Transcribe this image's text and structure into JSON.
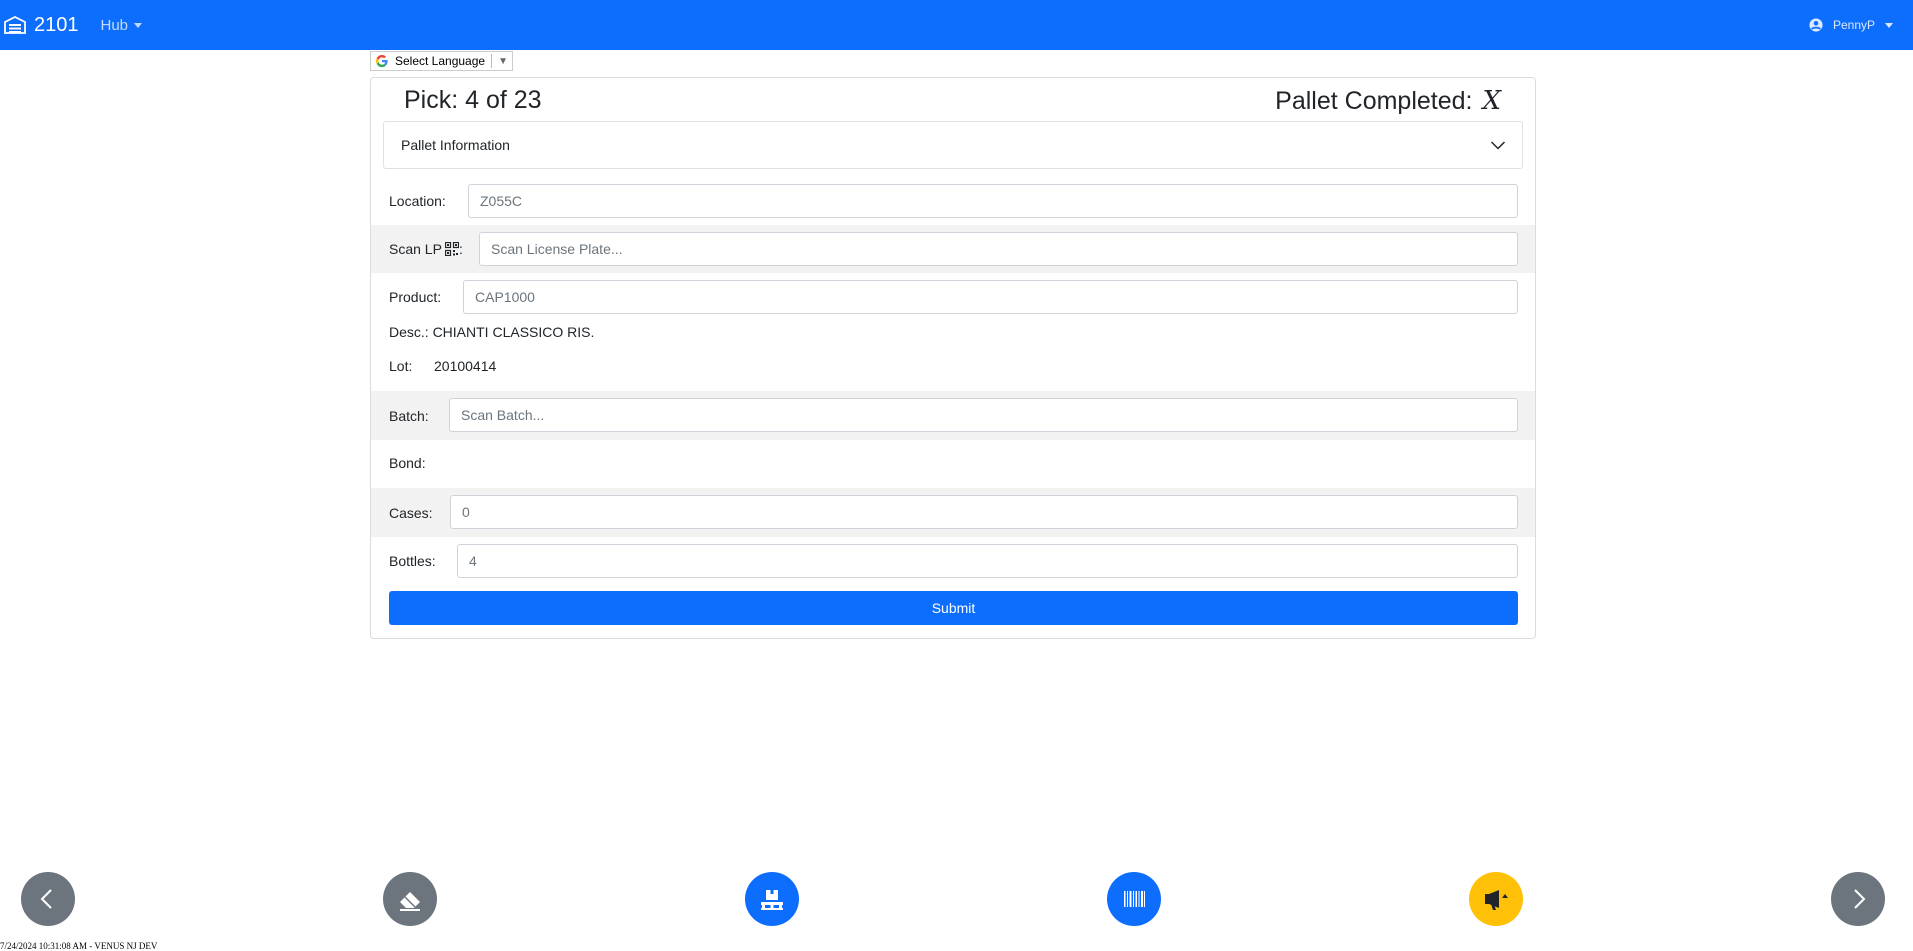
{
  "navbar": {
    "brand": "2101",
    "menu": "Hub",
    "user": "PennyP"
  },
  "translate": {
    "label": "Select Language",
    "arrow": "▼"
  },
  "pick": {
    "text": "Pick: 4 of 23",
    "pallet_completed_label": "Pallet Completed:",
    "pallet_completed_mark": "X"
  },
  "accordion": {
    "title": "Pallet Information"
  },
  "form": {
    "location": {
      "label": "Location:",
      "value": "Z055C"
    },
    "scan_lp": {
      "label": "Scan LP",
      "suffix": ":",
      "placeholder": "Scan License Plate..."
    },
    "product": {
      "label": "Product:",
      "value": "CAP1000"
    },
    "desc": {
      "text": "Desc.: CHIANTI CLASSICO RIS."
    },
    "lot": {
      "label": "Lot:",
      "value": "20100414"
    },
    "batch": {
      "label": "Batch:",
      "placeholder": "Scan Batch..."
    },
    "bond": {
      "label": "Bond:"
    },
    "cases": {
      "label": "Cases:",
      "value": "0"
    },
    "bottles": {
      "label": "Bottles:",
      "value": "4"
    },
    "submit": "Submit"
  },
  "footer": {
    "status": "7/24/2024 10:31:08 AM - VENUS NJ DEV"
  },
  "colors": {
    "primary": "#0d6efd",
    "secondary": "#6c757d",
    "warning": "#ffc107"
  }
}
